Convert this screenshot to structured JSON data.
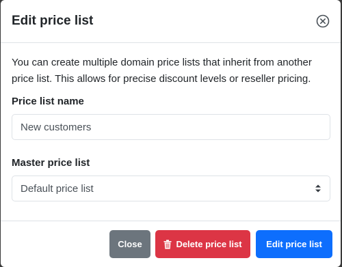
{
  "modal": {
    "title": "Edit price list",
    "description": "You can create multiple domain price lists that inherit from another price list. This allows for precise discount levels or reseller pricing."
  },
  "form": {
    "name_label": "Price list name",
    "name_value": "New customers",
    "master_label": "Master price list",
    "master_value": "Default price list"
  },
  "footer": {
    "close_label": "Close",
    "delete_label": "Delete price list",
    "edit_label": "Edit price list"
  },
  "icons": {
    "close": "circle-x-icon",
    "delete": "trash-icon",
    "select": "select-arrows-icon"
  },
  "colors": {
    "close_button": "#6c757d",
    "delete_button": "#dc3545",
    "edit_button": "#0d6efd"
  }
}
